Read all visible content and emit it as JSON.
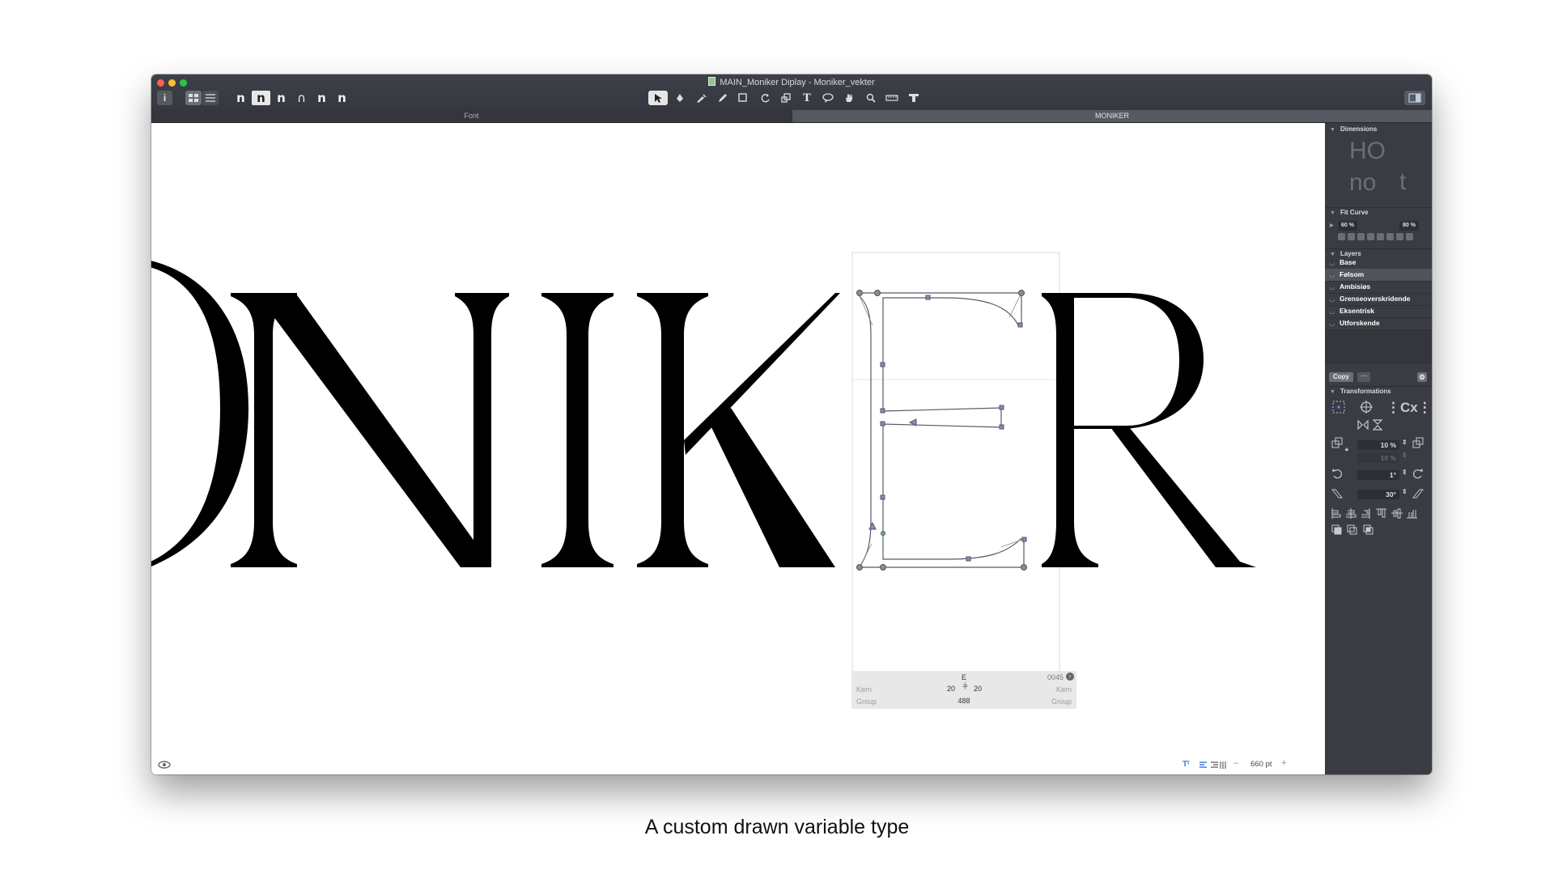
{
  "window": {
    "title": "MAIN_Moniker Diplay - Moniker_vekter"
  },
  "toolbar": {
    "info_icon": "i",
    "view_icons": [
      "grid-view-icon",
      "list-view-icon"
    ],
    "glyph_buttons": [
      "n",
      "n",
      "n",
      "∩",
      "n",
      "n"
    ],
    "tools": [
      "pointer-tool-icon",
      "pen-tool-icon",
      "draw-tool-icon",
      "pencil-tool-icon",
      "rectangle-tool-icon",
      "rotate-tool-icon",
      "scale-tool-icon",
      "text-tool-icon",
      "annotation-tool-icon",
      "hand-tool-icon",
      "zoom-tool-icon",
      "measure-tool-icon",
      "type-tool-icon"
    ],
    "text_tool_label": "T"
  },
  "tabs": [
    {
      "label": "Font"
    },
    {
      "label": "MONIKER"
    }
  ],
  "canvas": {
    "text": "ONIKER",
    "active_glyph": "E"
  },
  "glyph_info": {
    "name": "E",
    "unicode": "0045",
    "kern_label": "Kern",
    "group_label": "Group",
    "lsb": "20",
    "rsb": "20",
    "width": "488"
  },
  "bottom": {
    "zoom": "660 pt",
    "minus": "–",
    "plus": "+"
  },
  "sidebar": {
    "dimensions_title": "Dimensions",
    "dim_letters": [
      "HO",
      "no",
      "t"
    ],
    "fit_curve_title": "Fit Curve",
    "fit_min": "60 %",
    "fit_max": "80 %",
    "layers_title": "Layers",
    "layers": [
      {
        "name": "Base",
        "selected": false
      },
      {
        "name": "Følsom",
        "selected": true
      },
      {
        "name": "Ambisiøs",
        "selected": false
      },
      {
        "name": "Grenseoverskridende",
        "selected": false
      },
      {
        "name": "Eksentrisk",
        "selected": false
      },
      {
        "name": "Utforskende",
        "selected": false
      }
    ],
    "copy_label": "Copy",
    "transformations_title": "Transformations",
    "scale_x": "10 %",
    "scale_y": "10 %",
    "rotate": "1°",
    "slant": "30°"
  },
  "caption": "A custom drawn variable type",
  "colors": {
    "titlebar": "#3d4048",
    "sidebar": "#3a3c43",
    "selected_layer": "#50535b",
    "outline": "#555a66",
    "node": "#8c8c8c"
  }
}
